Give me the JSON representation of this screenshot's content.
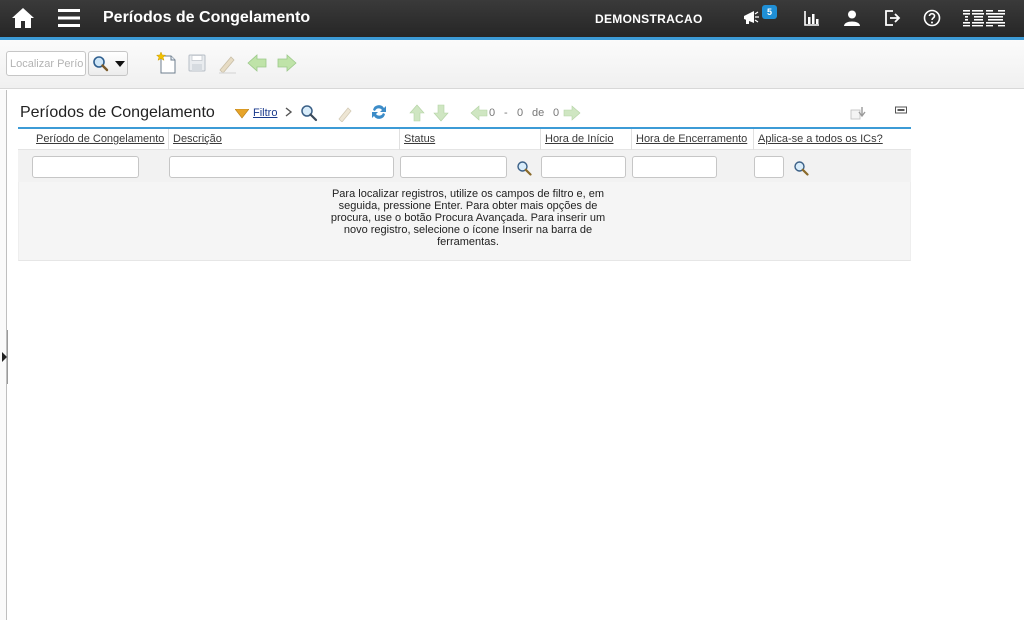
{
  "header": {
    "app_title": "Períodos de Congelamento",
    "user_name": "DEMONSTRACAO",
    "notification_count": "5",
    "brand": "IBM",
    "icons": [
      "home-icon",
      "menu-icon",
      "megaphone-icon",
      "chart-icon",
      "user-icon",
      "logout-icon",
      "help-icon",
      "ibm-logo"
    ],
    "accent_color": "#3c9bd6"
  },
  "toolbar": {
    "search_placeholder": "Localizar Perío",
    "icons": [
      "search-dropdown-icon",
      "new-record-icon",
      "save-icon",
      "clear-changes-icon",
      "previous-record-icon",
      "next-record-icon"
    ]
  },
  "section": {
    "title": "Períodos de Congelamento",
    "filter_label": "Filtro",
    "pager": {
      "start": "0",
      "separator": "-",
      "end": "0",
      "of_label": "de",
      "total": "0"
    }
  },
  "table": {
    "columns": [
      "Período de Congelamento",
      "Descrição",
      "Status",
      "Hora de Início",
      "Hora de Encerramento",
      "Aplica-se a todos os ICs?"
    ],
    "filter_values": [
      "",
      "",
      "",
      "",
      "",
      ""
    ],
    "empty_message": "Para localizar registros, utilize os campos de filtro e, em seguida, pressione Enter. Para obter mais opções de procura, use o botão Procura Avançada. Para inserir um novo registro, selecione o ícone Inserir na barra de ferramentas."
  }
}
